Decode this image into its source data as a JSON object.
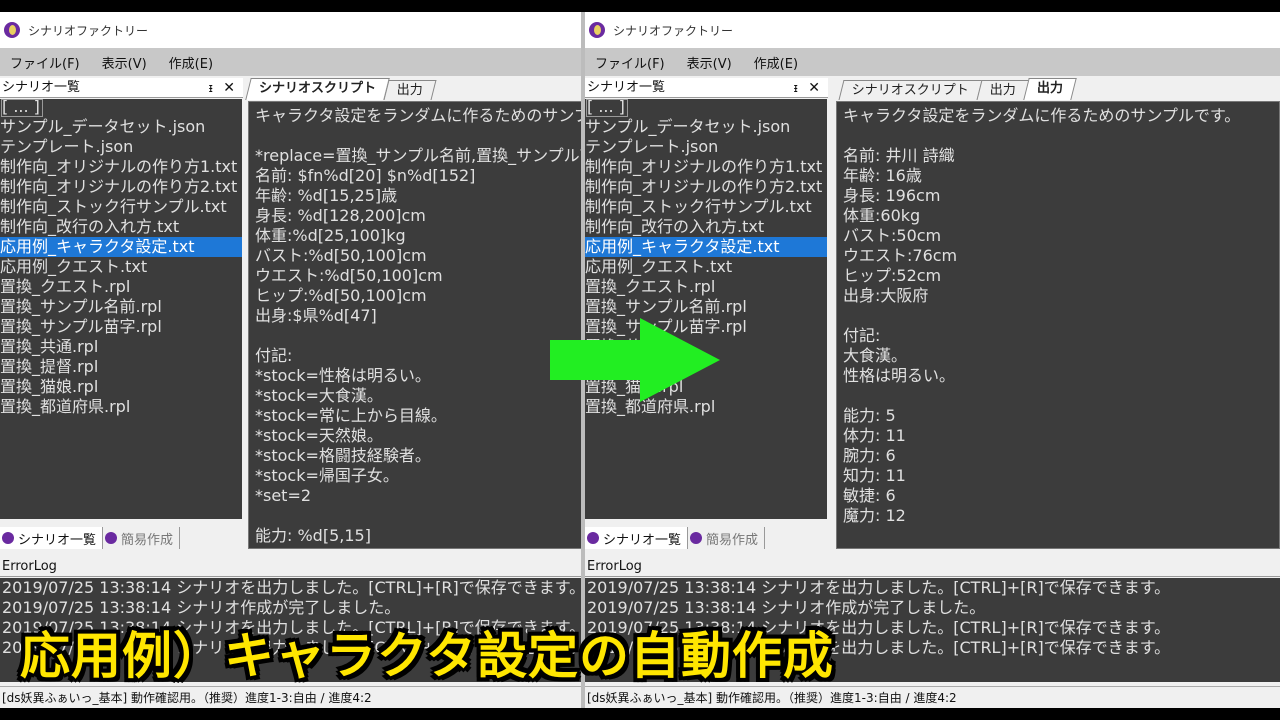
{
  "app": {
    "title": "シナリオファクトリー"
  },
  "menu": {
    "file": "ファイル(F)",
    "view": "表示(V)",
    "create": "作成(E)"
  },
  "sidebar": {
    "title": "シナリオ一覧",
    "pin_icon": "pin-icon",
    "close_icon": "close-icon",
    "items": [
      "[ ... ]",
      "サンプル_データセット.json",
      "テンプレート.json",
      "制作向_オリジナルの作り方1.txt",
      "制作向_オリジナルの作り方2.txt",
      "制作向_ストック行サンプル.txt",
      "制作向_改行の入れ方.txt",
      "応用例_キャラクタ設定.txt",
      "応用例_クエスト.txt",
      "置換_クエスト.rpl",
      "置換_サンプル名前.rpl",
      "置換_サンプル苗字.rpl",
      "置換_共通.rpl",
      "置換_提督.rpl",
      "置換_猫娘.rpl",
      "置換_都道府県.rpl"
    ],
    "selected_index": 7,
    "tabs": [
      "シナリオ一覧",
      "簡易作成"
    ]
  },
  "left_editor": {
    "tabs": [
      "シナリオスクリプト",
      "出力"
    ],
    "active_tab": 0,
    "lines": [
      "キャラクタ設定をランダムに作るためのサンプルです。",
      "",
      "*replace=置換_サンプル名前,置換_サンプル苗字",
      "名前: $fn%d[20] $n%d[152]",
      "年齢: %d[15,25]歳",
      "身長: %d[128,200]cm",
      "体重:%d[25,100]kg",
      "バスト:%d[50,100]cm",
      "ウエスト:%d[50,100]cm",
      "ヒップ:%d[50,100]cm",
      "出身:$県%d[47]",
      "",
      "付記:",
      "*stock=性格は明るい。",
      "*stock=大食漢。",
      "*stock=常に上から目線。",
      "*stock=天然娘。",
      "*stock=格闘技経験者。",
      "*stock=帰国子女。",
      "*set=2",
      "",
      "能力: %d[5,15]"
    ]
  },
  "right_editor": {
    "tabs": [
      "シナリオスクリプト",
      "出力",
      "出力"
    ],
    "active_tab": 2,
    "lines": [
      "キャラクタ設定をランダムに作るためのサンプルです。",
      "",
      "名前: 井川 詩織",
      "年齢: 16歳",
      "身長: 196cm",
      "体重:60kg",
      "バスト:50cm",
      "ウエスト:76cm",
      "ヒップ:52cm",
      "出身:大阪府",
      "",
      "付記:",
      "大食漢。",
      "性格は明るい。",
      "",
      "能力: 5",
      "体力: 11",
      "腕力: 6",
      "知力: 11",
      "敏捷: 6",
      "魔力: 12"
    ]
  },
  "errorlog": {
    "title": "ErrorLog",
    "lines": [
      "2019/07/25 13:38:14 シナリオを出力しました。[CTRL]+[R]で保存できます。",
      "2019/07/25 13:38:14 シナリオ作成が完了しました。",
      "2019/07/25 13:38:14 シナリオを出力しました。[CTRL]+[R]で保存できます。",
      "2019/07/25 13:38:14 シナリオを出力しました。[CTRL]+[R]で保存できます。"
    ]
  },
  "status": {
    "text": "[ds妖異ふぁいっ_基本] 動作確認用。（推奨）進度1-3:自由 / 進度4:2"
  },
  "caption": {
    "text": "応用例）キャラクタ設定の自動作成"
  },
  "colors": {
    "arrow": "#22ee22",
    "caption": "#ffe600",
    "selection": "#1e78d7"
  }
}
